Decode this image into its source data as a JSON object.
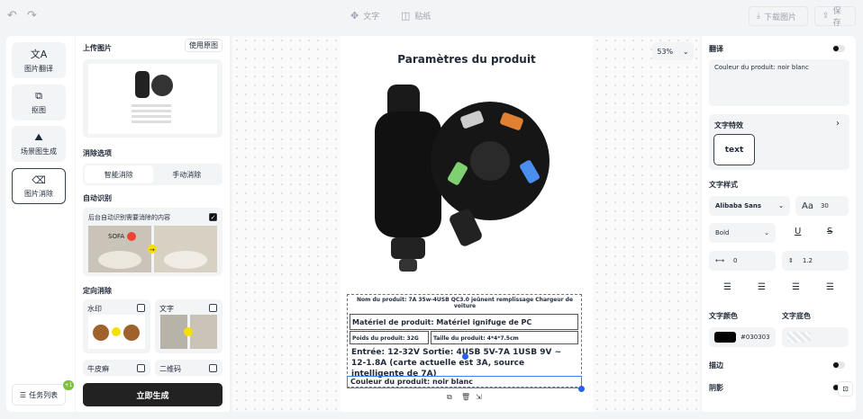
{
  "toolbar": {
    "text": "文字",
    "sticker": "贴纸",
    "download": "下载图片",
    "save": "保存"
  },
  "nav": {
    "translate": "图片翻译",
    "cutout": "抠图",
    "scene": "场景图生成",
    "erase": "图片消除",
    "tasks": "任务列表",
    "badge": "+1"
  },
  "left": {
    "upload_title": "上传图片",
    "use_original": "使用原图",
    "remove_options": "消除选项",
    "smart": "智能消除",
    "manual": "手动消除",
    "auto_detect": "自动识别",
    "auto_desc": "后台自动识别需要消除的内容",
    "directed": "定向消除",
    "watermark": "水印",
    "text": "文字",
    "psoriasis": "牛皮癣",
    "qrcode": "二维码",
    "generate": "立即生成",
    "sofa": "SOFA"
  },
  "canvas": {
    "zoom": "53%",
    "title": "Paramètres du produit",
    "r1": "Nom du produit: 7A 35w-4USB QC3.0 jeûnent remplissage Chargeur de voiture",
    "r2": "Matériel de produit: Matériel ignifuge de PC",
    "r3a": "Poids du produit: 32G",
    "r3b": "Taille du produit: 4*4*7.5cm",
    "r4": "Entrée: 12-32V Sortie: 4USB 5V-7A 1USB 9V ~ 12-1.8A (carte actuelle est 3A, source intelligente de 7A)",
    "r5": "Couleur du produit: noir blanc"
  },
  "right": {
    "translate": "翻译",
    "trans_text": "Couleur du produit: noir blanc",
    "effect": "文字特效",
    "effect_sample": "text",
    "style": "文字样式",
    "font": "Alibaba Sans",
    "size": "30",
    "weight": "Bold",
    "spacing": "0",
    "line": "1.2",
    "color_lbl": "文字颜色",
    "bg_lbl": "文字底色",
    "color": "#030303",
    "stroke": "描边",
    "shadow": "阴影"
  }
}
